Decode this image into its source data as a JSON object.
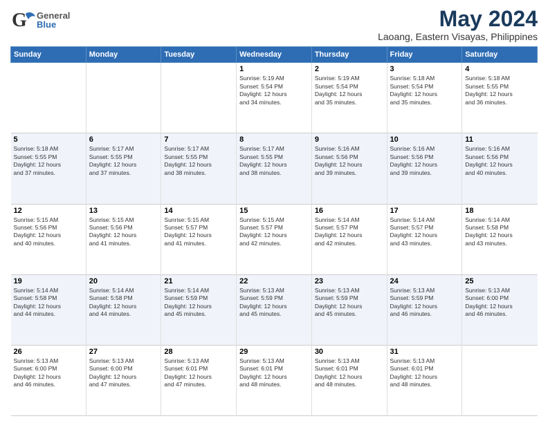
{
  "header": {
    "logo_general": "General",
    "logo_blue": "Blue",
    "main_title": "May 2024",
    "subtitle": "Laoang, Eastern Visayas, Philippines"
  },
  "calendar": {
    "days": [
      "Sunday",
      "Monday",
      "Tuesday",
      "Wednesday",
      "Thursday",
      "Friday",
      "Saturday"
    ],
    "weeks": [
      {
        "row_class": "row-normal",
        "cells": [
          {
            "date": "",
            "text": ""
          },
          {
            "date": "",
            "text": ""
          },
          {
            "date": "",
            "text": ""
          },
          {
            "date": "1",
            "text": "Sunrise: 5:19 AM\nSunset: 5:54 PM\nDaylight: 12 hours\nand 34 minutes."
          },
          {
            "date": "2",
            "text": "Sunrise: 5:19 AM\nSunset: 5:54 PM\nDaylight: 12 hours\nand 35 minutes."
          },
          {
            "date": "3",
            "text": "Sunrise: 5:18 AM\nSunset: 5:54 PM\nDaylight: 12 hours\nand 35 minutes."
          },
          {
            "date": "4",
            "text": "Sunrise: 5:18 AM\nSunset: 5:55 PM\nDaylight: 12 hours\nand 36 minutes."
          }
        ]
      },
      {
        "row_class": "row-alt",
        "cells": [
          {
            "date": "5",
            "text": "Sunrise: 5:18 AM\nSunset: 5:55 PM\nDaylight: 12 hours\nand 37 minutes."
          },
          {
            "date": "6",
            "text": "Sunrise: 5:17 AM\nSunset: 5:55 PM\nDaylight: 12 hours\nand 37 minutes."
          },
          {
            "date": "7",
            "text": "Sunrise: 5:17 AM\nSunset: 5:55 PM\nDaylight: 12 hours\nand 38 minutes."
          },
          {
            "date": "8",
            "text": "Sunrise: 5:17 AM\nSunset: 5:55 PM\nDaylight: 12 hours\nand 38 minutes."
          },
          {
            "date": "9",
            "text": "Sunrise: 5:16 AM\nSunset: 5:56 PM\nDaylight: 12 hours\nand 39 minutes."
          },
          {
            "date": "10",
            "text": "Sunrise: 5:16 AM\nSunset: 5:56 PM\nDaylight: 12 hours\nand 39 minutes."
          },
          {
            "date": "11",
            "text": "Sunrise: 5:16 AM\nSunset: 5:56 PM\nDaylight: 12 hours\nand 40 minutes."
          }
        ]
      },
      {
        "row_class": "row-normal",
        "cells": [
          {
            "date": "12",
            "text": "Sunrise: 5:15 AM\nSunset: 5:56 PM\nDaylight: 12 hours\nand 40 minutes."
          },
          {
            "date": "13",
            "text": "Sunrise: 5:15 AM\nSunset: 5:56 PM\nDaylight: 12 hours\nand 41 minutes."
          },
          {
            "date": "14",
            "text": "Sunrise: 5:15 AM\nSunset: 5:57 PM\nDaylight: 12 hours\nand 41 minutes."
          },
          {
            "date": "15",
            "text": "Sunrise: 5:15 AM\nSunset: 5:57 PM\nDaylight: 12 hours\nand 42 minutes."
          },
          {
            "date": "16",
            "text": "Sunrise: 5:14 AM\nSunset: 5:57 PM\nDaylight: 12 hours\nand 42 minutes."
          },
          {
            "date": "17",
            "text": "Sunrise: 5:14 AM\nSunset: 5:57 PM\nDaylight: 12 hours\nand 43 minutes."
          },
          {
            "date": "18",
            "text": "Sunrise: 5:14 AM\nSunset: 5:58 PM\nDaylight: 12 hours\nand 43 minutes."
          }
        ]
      },
      {
        "row_class": "row-alt",
        "cells": [
          {
            "date": "19",
            "text": "Sunrise: 5:14 AM\nSunset: 5:58 PM\nDaylight: 12 hours\nand 44 minutes."
          },
          {
            "date": "20",
            "text": "Sunrise: 5:14 AM\nSunset: 5:58 PM\nDaylight: 12 hours\nand 44 minutes."
          },
          {
            "date": "21",
            "text": "Sunrise: 5:14 AM\nSunset: 5:59 PM\nDaylight: 12 hours\nand 45 minutes."
          },
          {
            "date": "22",
            "text": "Sunrise: 5:13 AM\nSunset: 5:59 PM\nDaylight: 12 hours\nand 45 minutes."
          },
          {
            "date": "23",
            "text": "Sunrise: 5:13 AM\nSunset: 5:59 PM\nDaylight: 12 hours\nand 45 minutes."
          },
          {
            "date": "24",
            "text": "Sunrise: 5:13 AM\nSunset: 5:59 PM\nDaylight: 12 hours\nand 46 minutes."
          },
          {
            "date": "25",
            "text": "Sunrise: 5:13 AM\nSunset: 6:00 PM\nDaylight: 12 hours\nand 46 minutes."
          }
        ]
      },
      {
        "row_class": "row-normal",
        "cells": [
          {
            "date": "26",
            "text": "Sunrise: 5:13 AM\nSunset: 6:00 PM\nDaylight: 12 hours\nand 46 minutes."
          },
          {
            "date": "27",
            "text": "Sunrise: 5:13 AM\nSunset: 6:00 PM\nDaylight: 12 hours\nand 47 minutes."
          },
          {
            "date": "28",
            "text": "Sunrise: 5:13 AM\nSunset: 6:01 PM\nDaylight: 12 hours\nand 47 minutes."
          },
          {
            "date": "29",
            "text": "Sunrise: 5:13 AM\nSunset: 6:01 PM\nDaylight: 12 hours\nand 48 minutes."
          },
          {
            "date": "30",
            "text": "Sunrise: 5:13 AM\nSunset: 6:01 PM\nDaylight: 12 hours\nand 48 minutes."
          },
          {
            "date": "31",
            "text": "Sunrise: 5:13 AM\nSunset: 6:01 PM\nDaylight: 12 hours\nand 48 minutes."
          },
          {
            "date": "",
            "text": ""
          }
        ]
      }
    ]
  }
}
